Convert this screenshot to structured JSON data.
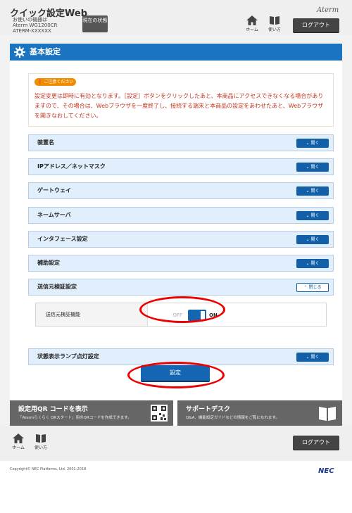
{
  "header": {
    "app_title": "クイック設定Web",
    "device_caption": "お使いの機器は",
    "device_model": "Aterm WG1200CR",
    "device_id": "ATERM-XXXXXX",
    "status_label": "現在の状態",
    "brand": "Aterm",
    "home_label": "ホーム",
    "help_label": "使い方",
    "logout_label": "ログアウト"
  },
  "page": {
    "title": "基本設定",
    "notice_badge": "ご注意ください",
    "notice_text": "設定変更は即時に有効となります。［設定］ボタンをクリックしたあと、本商品にアクセスできなくなる場合がありますので、その場合は、Webブラウザを一度終了し、接続する端末と本商品の設定をあわせたあと、Webブラウザを開きなおしてください。"
  },
  "sections": [
    {
      "label": "装置名",
      "toggle": "開く"
    },
    {
      "label": "IPアドレス／ネットマスク",
      "toggle": "開く"
    },
    {
      "label": "ゲートウェイ",
      "toggle": "開く"
    },
    {
      "label": "ネームサーバ",
      "toggle": "開く"
    },
    {
      "label": "インタフェース設定",
      "toggle": "開く"
    },
    {
      "label": "補助設定",
      "toggle": "開く"
    },
    {
      "label": "送信元検証設定",
      "toggle": "閉じる"
    },
    {
      "label": "状態表示ランプ点灯設定",
      "toggle": "開く"
    }
  ],
  "source_verification": {
    "label": "送信元検証機能",
    "off_label": "OFF",
    "on_label": "ON",
    "state": "ON"
  },
  "submit_label": "設定",
  "promo": {
    "qr_title": "設定用QR コードを表示",
    "qr_desc": "「Atermらくらく QRスタート」用のQRコードを作成できます。",
    "support_title": "サポートデスク",
    "support_desc": "Q&A、機能設定ガイドなどの情報をご覧になれます。"
  },
  "footer": {
    "home_label": "ホーム",
    "help_label": "使い方",
    "logout_label": "ログアウト",
    "copyright": "Copyright© NEC Platforms, Ltd. 2001-2018",
    "logo": "NEC"
  },
  "colors": {
    "accent": "#1a74bf",
    "button_blue": "#1466b3",
    "notice_text": "#c13521",
    "highlight_ring": "#ee0000"
  }
}
